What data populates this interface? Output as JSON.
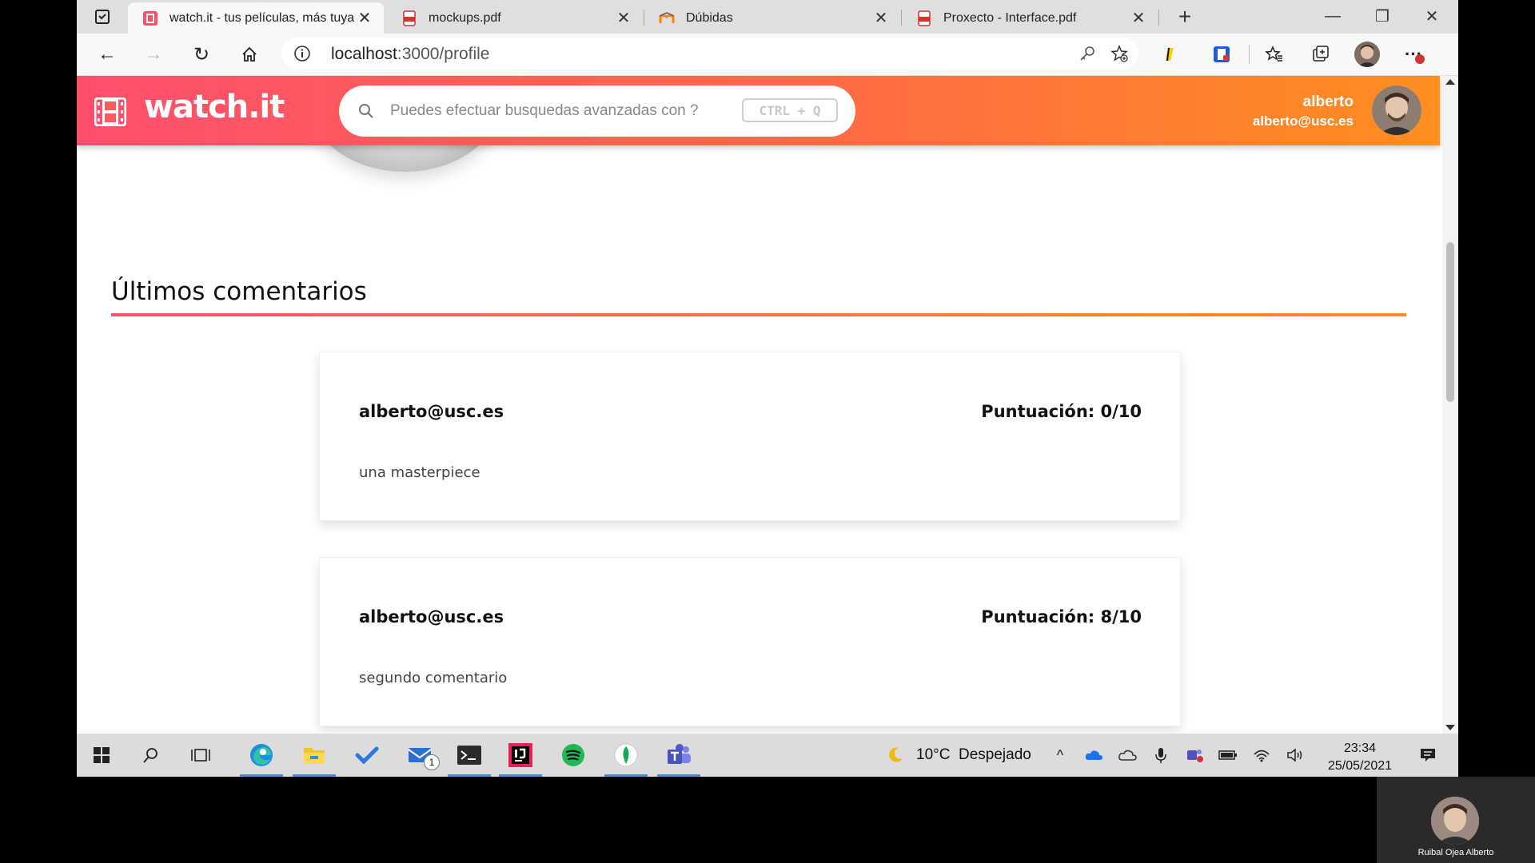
{
  "browser": {
    "tabs": [
      {
        "title": "watch.it - tus películas, más tuya",
        "favicon": "watchit-logo-icon",
        "active": true
      },
      {
        "title": "mockups.pdf",
        "favicon": "pdf-icon",
        "active": false
      },
      {
        "title": "Dúbidas",
        "favicon": "moodle-icon",
        "active": false
      },
      {
        "title": "Proxecto - Interface.pdf",
        "favicon": "pdf-icon",
        "active": false
      }
    ],
    "url_host": "localhost",
    "url_path": ":3000/profile"
  },
  "app": {
    "logo": "watch.it",
    "search_placeholder": "Puedes efectuar busquedas avanzadas con ?",
    "search_shortcut": "CTRL + Q",
    "user_name": "alberto",
    "user_email": "alberto@usc.es"
  },
  "comments_section": {
    "title": "Últimos comentarios",
    "comments": [
      {
        "author": "alberto@usc.es",
        "score": "Puntuación: 0/10",
        "text": "una masterpiece"
      },
      {
        "author": "alberto@usc.es",
        "score": "Puntuación: 8/10",
        "text": "segundo comentario"
      }
    ]
  },
  "taskbar": {
    "mail_badge": "1",
    "weather": "10°C  Despejado",
    "time": "23:34",
    "date": "25/05/2021"
  },
  "video_call": {
    "participant": "Ruibal Ojea Alberto"
  },
  "colors": {
    "gradient_start": "#fd4f6d",
    "gradient_end": "#ff8e1f",
    "taskbar_accent": "#4a8fd8"
  }
}
